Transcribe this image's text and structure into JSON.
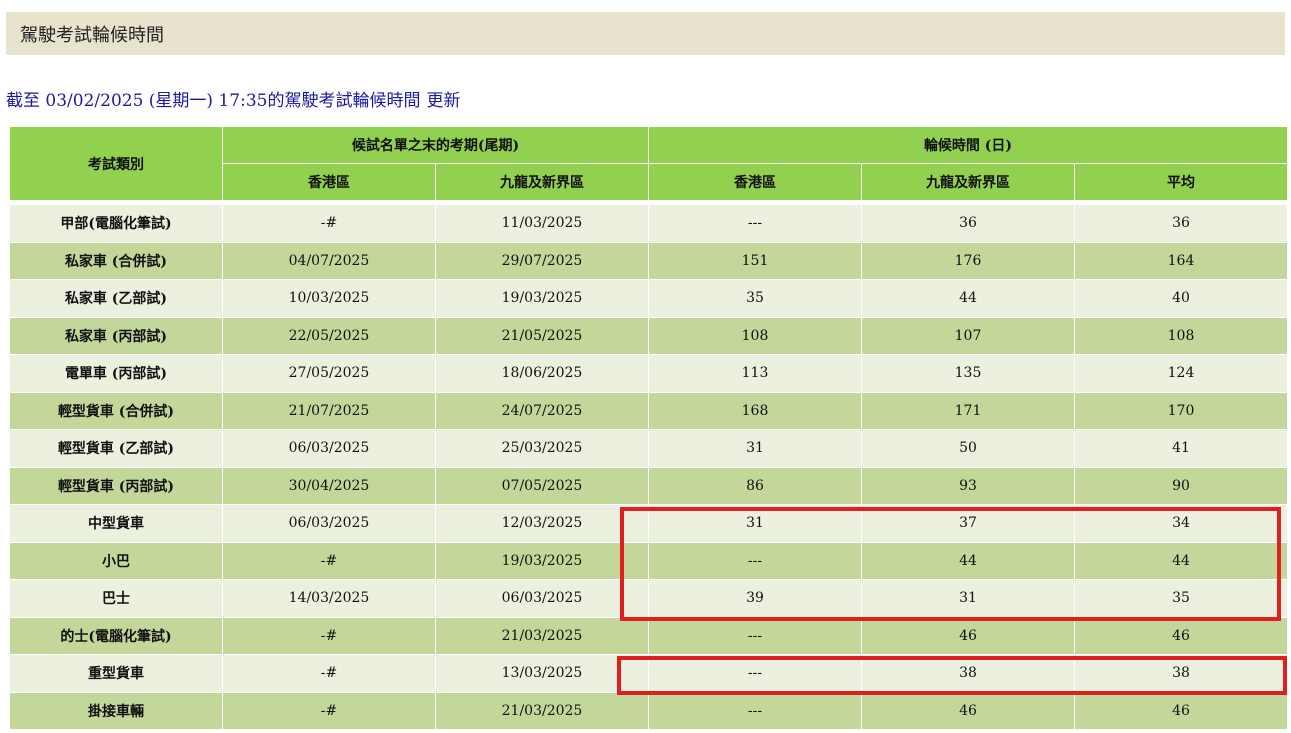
{
  "page_title": "駕駛考試輪候時間",
  "update": {
    "text": "截至 03/02/2025 (星期一) 17:35的駕駛考試輪候時間",
    "refresh_label": "更新"
  },
  "table": {
    "header": {
      "category": "考試類別",
      "group_last_date": "候試名單之末的考期(尾期)",
      "group_wait": "輪候時間 (日)",
      "hk": "香港區",
      "kln_nt": "九龍及新界區",
      "hk2": "香港區",
      "kln_nt2": "九龍及新界區",
      "avg": "平均"
    },
    "rows": [
      {
        "category": "甲部(電腦化筆試)",
        "hk_date": "-#",
        "kln_date": "11/03/2025",
        "hk_wait": "---",
        "kln_wait": "36",
        "avg": "36"
      },
      {
        "category": "私家車 (合併試)",
        "hk_date": "04/07/2025",
        "kln_date": "29/07/2025",
        "hk_wait": "151",
        "kln_wait": "176",
        "avg": "164"
      },
      {
        "category": "私家車 (乙部試)",
        "hk_date": "10/03/2025",
        "kln_date": "19/03/2025",
        "hk_wait": "35",
        "kln_wait": "44",
        "avg": "40"
      },
      {
        "category": "私家車 (丙部試)",
        "hk_date": "22/05/2025",
        "kln_date": "21/05/2025",
        "hk_wait": "108",
        "kln_wait": "107",
        "avg": "108"
      },
      {
        "category": "電單車 (丙部試)",
        "hk_date": "27/05/2025",
        "kln_date": "18/06/2025",
        "hk_wait": "113",
        "kln_wait": "135",
        "avg": "124"
      },
      {
        "category": "輕型貨車 (合併試)",
        "hk_date": "21/07/2025",
        "kln_date": "24/07/2025",
        "hk_wait": "168",
        "kln_wait": "171",
        "avg": "170"
      },
      {
        "category": "輕型貨車 (乙部試)",
        "hk_date": "06/03/2025",
        "kln_date": "25/03/2025",
        "hk_wait": "31",
        "kln_wait": "50",
        "avg": "41"
      },
      {
        "category": "輕型貨車 (丙部試)",
        "hk_date": "30/04/2025",
        "kln_date": "07/05/2025",
        "hk_wait": "86",
        "kln_wait": "93",
        "avg": "90"
      },
      {
        "category": "中型貨車",
        "hk_date": "06/03/2025",
        "kln_date": "12/03/2025",
        "hk_wait": "31",
        "kln_wait": "37",
        "avg": "34"
      },
      {
        "category": "小巴",
        "hk_date": "-#",
        "kln_date": "19/03/2025",
        "hk_wait": "---",
        "kln_wait": "44",
        "avg": "44"
      },
      {
        "category": "巴士",
        "hk_date": "14/03/2025",
        "kln_date": "06/03/2025",
        "hk_wait": "39",
        "kln_wait": "31",
        "avg": "35"
      },
      {
        "category": "的士(電腦化筆試)",
        "hk_date": "-#",
        "kln_date": "21/03/2025",
        "hk_wait": "---",
        "kln_wait": "46",
        "avg": "46"
      },
      {
        "category": "重型貨車",
        "hk_date": "-#",
        "kln_date": "13/03/2025",
        "hk_wait": "---",
        "kln_wait": "38",
        "avg": "38"
      },
      {
        "category": "掛接車輛",
        "hk_date": "-#",
        "kln_date": "21/03/2025",
        "hk_wait": "---",
        "kln_wait": "46",
        "avg": "46"
      }
    ]
  },
  "colors": {
    "header_green": "#92d050",
    "row_light": "#ebf1de",
    "row_dark": "#c4d79b",
    "title_bar": "#e8e3cd",
    "link_blue": "#1a1aa0",
    "highlight_red": "#e02020"
  }
}
